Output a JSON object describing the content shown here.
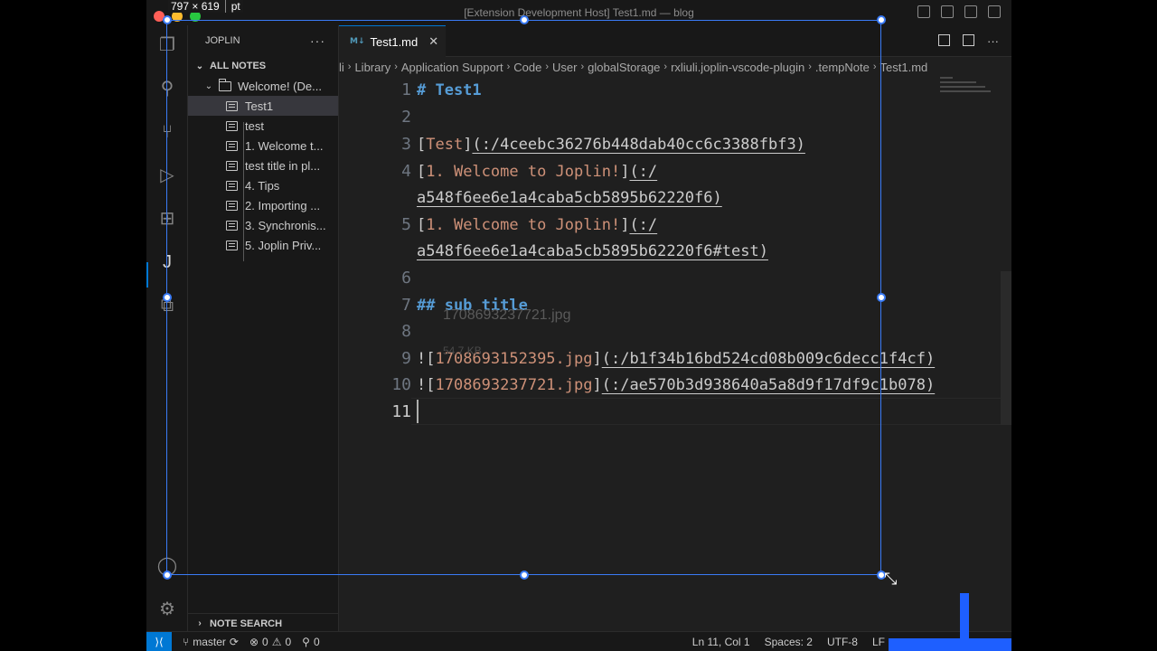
{
  "overlay": {
    "dims_value": "797 × 619",
    "dims_unit": "pt"
  },
  "window": {
    "title": "[Extension Development Host] Test1.md — blog"
  },
  "activity_bar": {
    "icons": [
      "files-icon",
      "search-icon",
      "source-control-icon",
      "run-debug-icon",
      "extensions-icon",
      "joplin-icon",
      "remote-explorer-icon",
      "account-icon",
      "settings-gear-icon"
    ]
  },
  "sidebar": {
    "header": "JOPLIN",
    "more": "···",
    "section": "ALL NOTES",
    "folder": "Welcome! (De...",
    "notes": [
      "Test1",
      "test",
      "1. Welcome t...",
      "test title in pl...",
      "4. Tips",
      "2. Importing ...",
      "3. Synchronis...",
      "5. Joplin Priv..."
    ],
    "note_search": "NOTE SEARCH"
  },
  "tab": {
    "label": "Test1.md",
    "icon": "M↓",
    "close": "✕"
  },
  "breadcrumbs": [
    "li",
    "Library",
    "Application Support",
    "Code",
    "User",
    "globalStorage",
    "rxliuli.joplin-vscode-plugin",
    ".tempNote",
    "Test1.md"
  ],
  "editor": {
    "line_numbers": [
      "1",
      "2",
      "3",
      "4",
      "",
      "5",
      "",
      "6",
      "7",
      "8",
      "9",
      "10",
      "11"
    ],
    "line1": "# Test1",
    "line3_text": "Test",
    "line3_url": "(:/4ceebc36276b448dab40cc6c3388fbf3)",
    "line4_text": "1. Welcome to Joplin!",
    "line4_url_a": "(:/",
    "line4_url_b": "a548f6ee6e1a4caba5cb5895b62220f6)",
    "line5_text": "1. Welcome to Joplin!",
    "line5_url_a": "(:/",
    "line5_url_b": "a548f6ee6e1a4caba5cb5895b62220f6#test)",
    "line7": "## sub title",
    "line9_text": "1708693152395.jpg",
    "line9_url": "(:/b1f34b16bd524cd08b009c6decc1f4cf)",
    "line10_text": "1708693237721.jpg",
    "line10_url": "(:/ae570b3d938640a5a8d9f17df9c1b078)",
    "hover_name": "1708693237721.jpg",
    "hover_size": "54.7 KB"
  },
  "statusbar": {
    "branch": "master",
    "sync": "⟳",
    "errors": "0",
    "warnings": "0",
    "ports": "0",
    "position": "Ln 11, Col 1",
    "spaces": "Spaces: 2",
    "encoding": "UTF-8",
    "eol": "LF"
  },
  "colors": {
    "accent": "#0078d4",
    "selection": "#3a7bf6",
    "heading": "#569cd6",
    "link_text": "#ce9178"
  }
}
